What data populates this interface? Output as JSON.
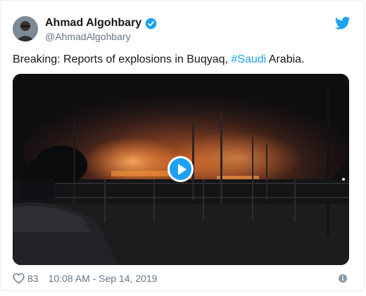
{
  "tweet": {
    "display_name": "Ahmad Algohbary",
    "handle": "@AhmadAlgohbary",
    "text_before": "Breaking: Reports of explosions in Buqyaq, ",
    "hashtag": "#Saudi",
    "text_after": " Arabia.",
    "likes": "83",
    "timestamp": "10:08 AM - Sep 14, 2019"
  },
  "icons": {
    "verified": "verified-badge-icon",
    "logo": "twitter-bird-icon",
    "like": "heart-icon",
    "info": "info-icon",
    "play": "play-icon"
  },
  "colors": {
    "accent": "#1da1f2",
    "text": "#14171a",
    "muted": "#657786",
    "border": "#e6ecf0"
  }
}
